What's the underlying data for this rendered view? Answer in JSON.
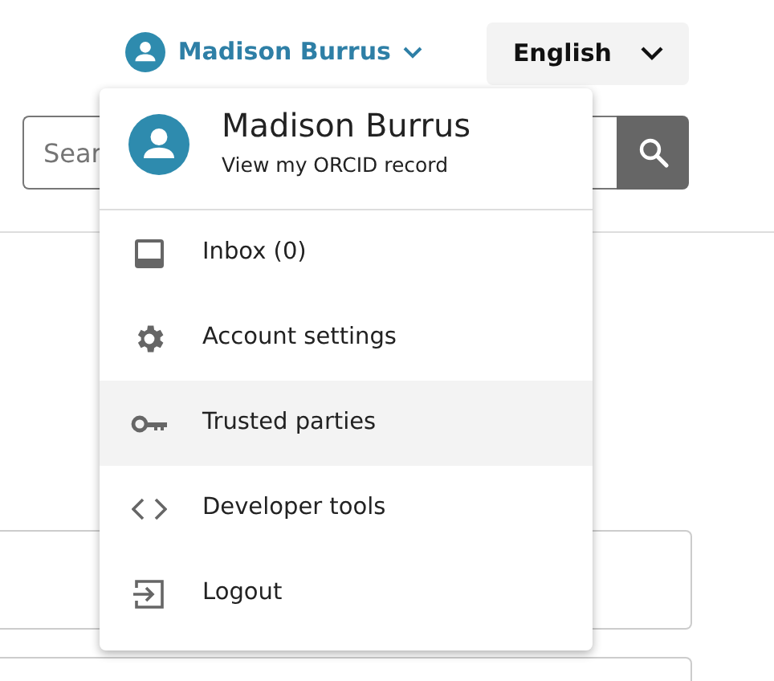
{
  "user_menu": {
    "name": "Madison Burrus",
    "expanded": true
  },
  "language": {
    "label": "English"
  },
  "search": {
    "placeholder": "Sear"
  },
  "dropdown": {
    "name": "Madison Burrus",
    "link": "View my ORCID record",
    "items": [
      {
        "kind": "inbox",
        "label": "Inbox (0)",
        "selected": false
      },
      {
        "kind": "settings",
        "label": "Account settings",
        "selected": false
      },
      {
        "kind": "key",
        "label": "Trusted parties",
        "selected": true
      },
      {
        "kind": "code",
        "label": "Developer tools",
        "selected": false
      },
      {
        "kind": "logout",
        "label": "Logout",
        "selected": false
      }
    ]
  }
}
